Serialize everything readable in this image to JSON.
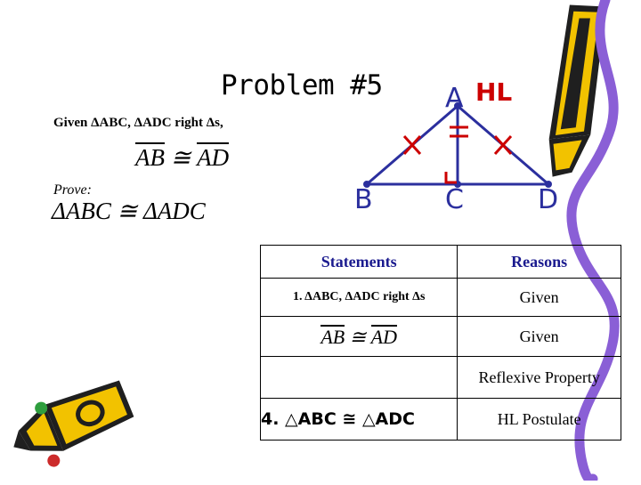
{
  "title": "Problem #5",
  "given": {
    "label": "Given ΔABC, ΔADC right Δs,",
    "congruence_left": "AB",
    "congruence_symbol": "≅",
    "congruence_right": "AD"
  },
  "prove": {
    "label": "Prove:",
    "statement": "ΔABC ≅ ΔADC"
  },
  "diagram": {
    "hl_label": "HL",
    "vertices": {
      "a": "A",
      "b": "B",
      "c": "C",
      "d": "D"
    },
    "marks": {
      "congruent_sides": "single tick",
      "right_angle": "square",
      "equal_segments": "double tick"
    },
    "colors": {
      "lines": "#2b2f9e",
      "tick_marks": "#cc0000",
      "labels": "#2b2f9e",
      "hl": "#cc0000"
    }
  },
  "table": {
    "headers": {
      "statements": "Statements",
      "reasons": "Reasons"
    },
    "rows": [
      {
        "statement": "1. ΔABC, ΔADC right Δs",
        "reason": "Given"
      },
      {
        "statement_overline_left": "AB",
        "statement_symbol": "≅",
        "statement_overline_right": "AD",
        "reason": "Given"
      },
      {
        "statement": "",
        "reason": "Reflexive Property"
      },
      {
        "statement": "4. △ABC ≅ △ADC",
        "reason": "HL  Postulate"
      }
    ]
  }
}
